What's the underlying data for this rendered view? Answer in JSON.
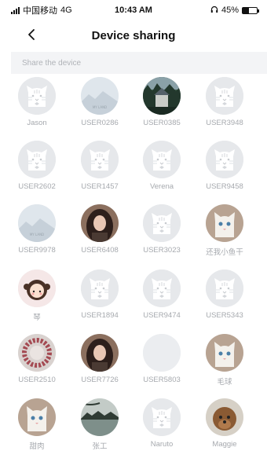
{
  "status_bar": {
    "carrier": "中国移动",
    "network": "4G",
    "time": "10:43 AM",
    "battery_text": "45%",
    "battery_level": 0.45
  },
  "header": {
    "title": "Device sharing",
    "back_icon": "chevron-left-icon"
  },
  "section_label": "Share the device",
  "users": [
    {
      "name": "Jason",
      "avatar": "cat"
    },
    {
      "name": "USER0286",
      "avatar": "landscape-light"
    },
    {
      "name": "USER0385",
      "avatar": "photo-forest"
    },
    {
      "name": "USER3948",
      "avatar": "cat"
    },
    {
      "name": "USER2602",
      "avatar": "cat"
    },
    {
      "name": "USER1457",
      "avatar": "cat"
    },
    {
      "name": "Verena",
      "avatar": "cat"
    },
    {
      "name": "USER9458",
      "avatar": "cat"
    },
    {
      "name": "USER9978",
      "avatar": "landscape-light"
    },
    {
      "name": "USER6408",
      "avatar": "photo-person"
    },
    {
      "name": "USER3023",
      "avatar": "cat"
    },
    {
      "name": "还我小鱼干",
      "avatar": "photo-cat-white"
    },
    {
      "name": "琴",
      "avatar": "cartoon-girl"
    },
    {
      "name": "USER1894",
      "avatar": "cat"
    },
    {
      "name": "USER9474",
      "avatar": "cat"
    },
    {
      "name": "USER5343",
      "avatar": "cat"
    },
    {
      "name": "USER2510",
      "avatar": "photo-wreath"
    },
    {
      "name": "USER7726",
      "avatar": "photo-person"
    },
    {
      "name": "USER5803",
      "avatar": "blank"
    },
    {
      "name": "毛球",
      "avatar": "photo-cat-white"
    },
    {
      "name": "甜肉",
      "avatar": "photo-cat-white"
    },
    {
      "name": "张工",
      "avatar": "photo-lake"
    },
    {
      "name": "Naruto",
      "avatar": "cat"
    },
    {
      "name": "Maggie",
      "avatar": "photo-dog"
    }
  ]
}
